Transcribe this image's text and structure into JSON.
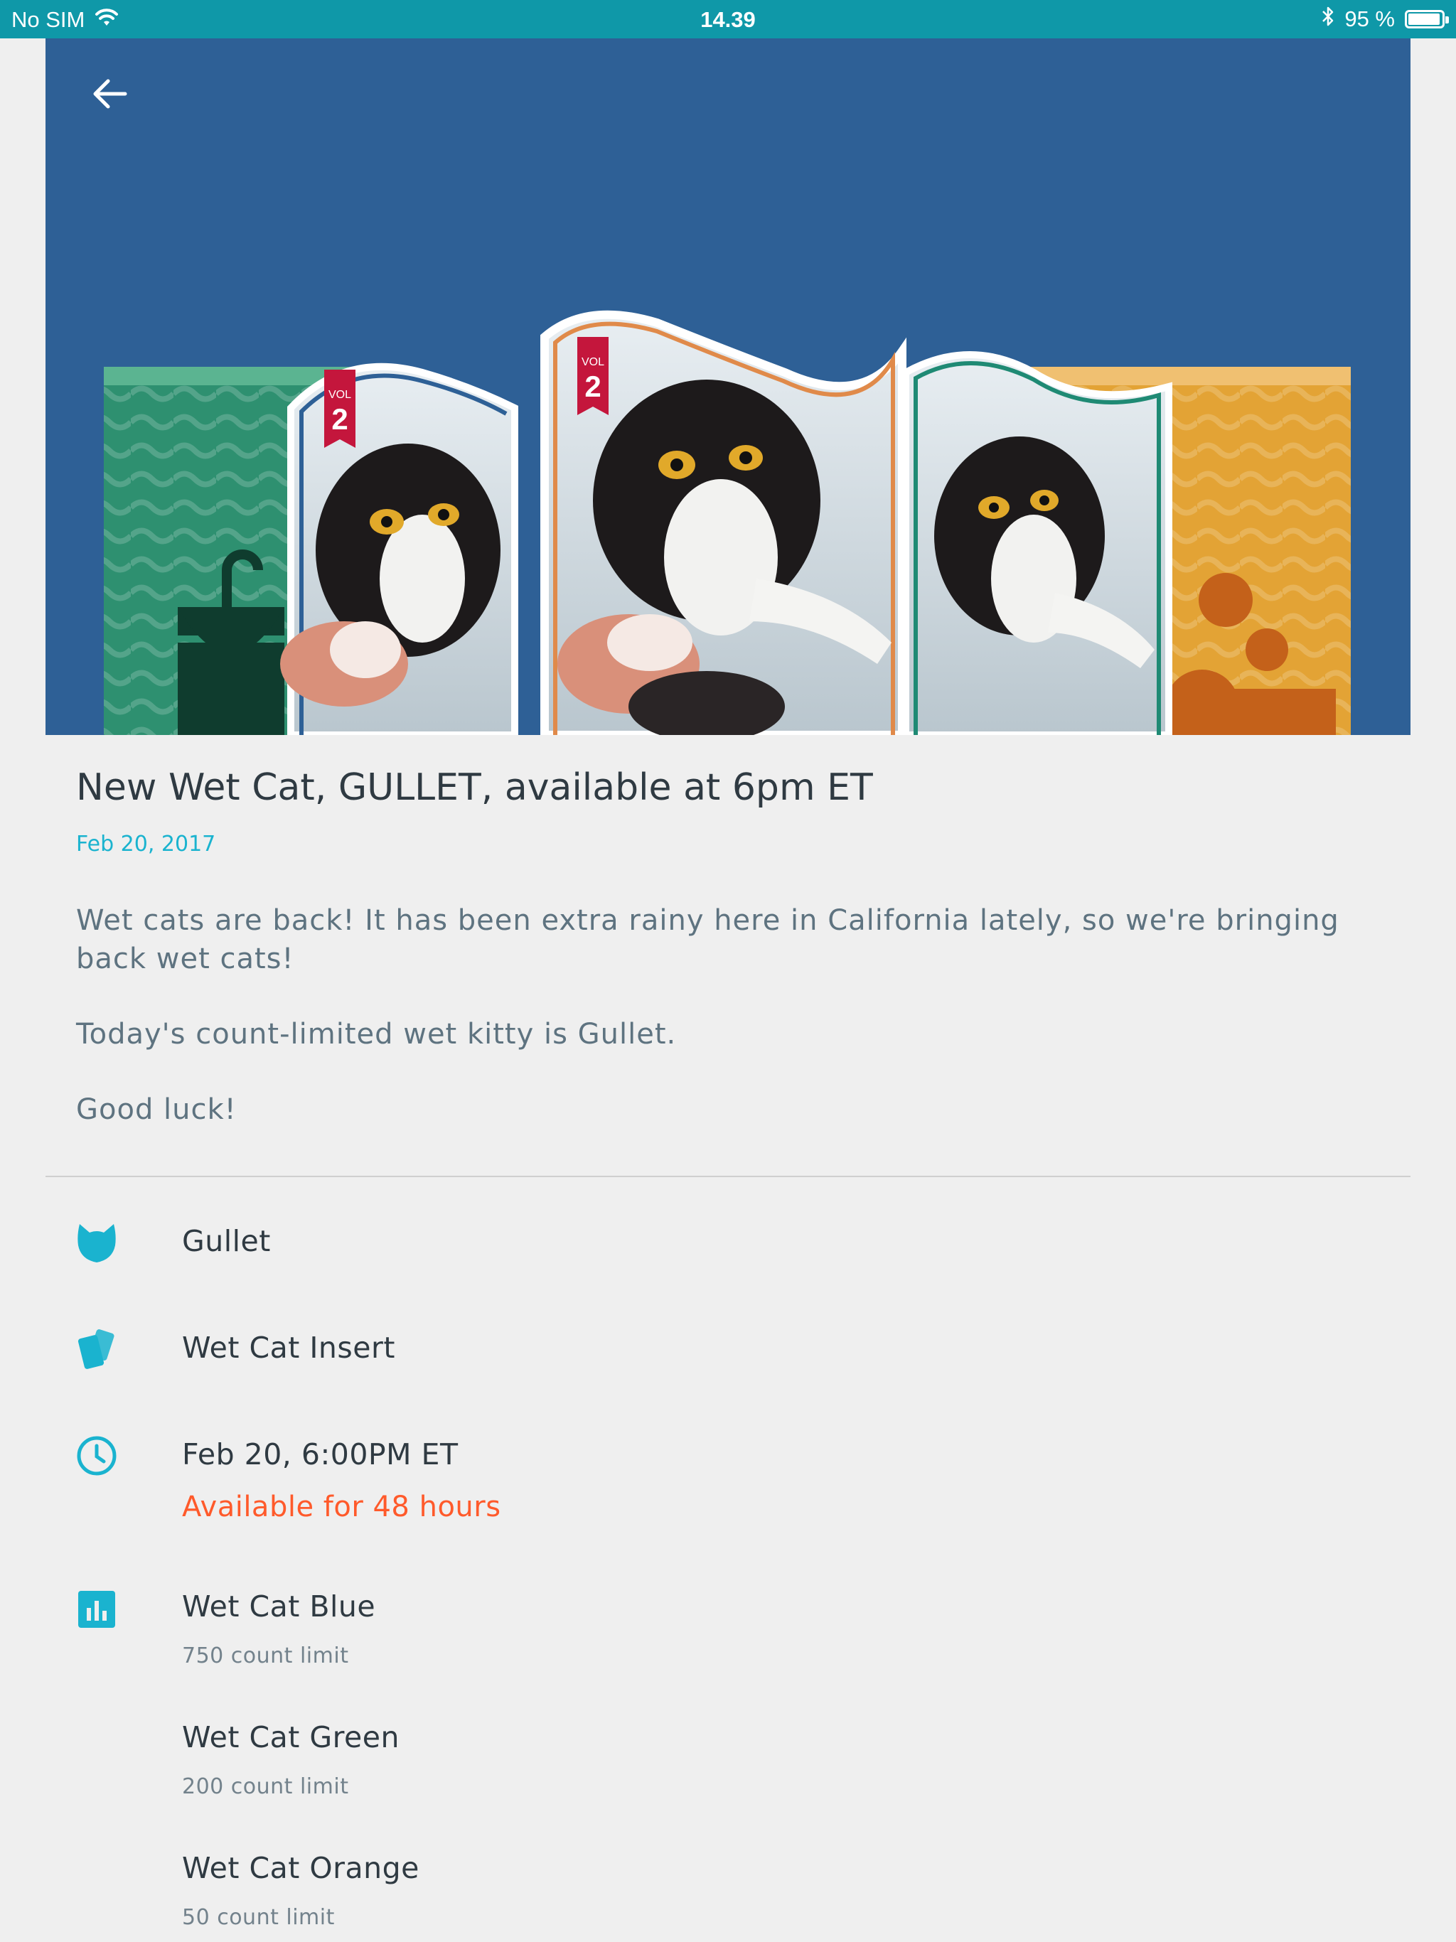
{
  "status_bar": {
    "carrier": "No SIM",
    "time": "14.39",
    "battery_text": "95 %",
    "battery_level": 0.95
  },
  "hero": {
    "background_color": "#2e6096",
    "badge_vol": "VOL",
    "badge_number": "2"
  },
  "article": {
    "title": "New Wet Cat, GULLET, available at 6pm ET",
    "date": "Feb 20, 2017",
    "paragraphs": [
      "Wet cats are back! It has been extra rainy here in California lately, so we're bringing back wet cats!",
      "Today's count-limited wet kitty is Gullet.",
      "Good luck!"
    ]
  },
  "details": {
    "cat_name": "Gullet",
    "item_type": "Wet Cat Insert",
    "release_time": "Feb 20, 6:00PM ET",
    "availability": "Available for 48 hours",
    "variants": [
      {
        "name": "Wet Cat Blue",
        "limit": "750 count limit"
      },
      {
        "name": "Wet Cat Green",
        "limit": "200 count limit"
      },
      {
        "name": "Wet Cat Orange",
        "limit": "50 count limit"
      }
    ]
  },
  "colors": {
    "status_bar": "#0f98a8",
    "accent": "#1ab3cf",
    "warning": "#ff5a2b"
  },
  "icons": [
    "back-arrow-icon",
    "wifi-icon",
    "bluetooth-icon",
    "battery-icon",
    "cat-icon",
    "cards-icon",
    "clock-icon",
    "bar-chart-icon"
  ]
}
